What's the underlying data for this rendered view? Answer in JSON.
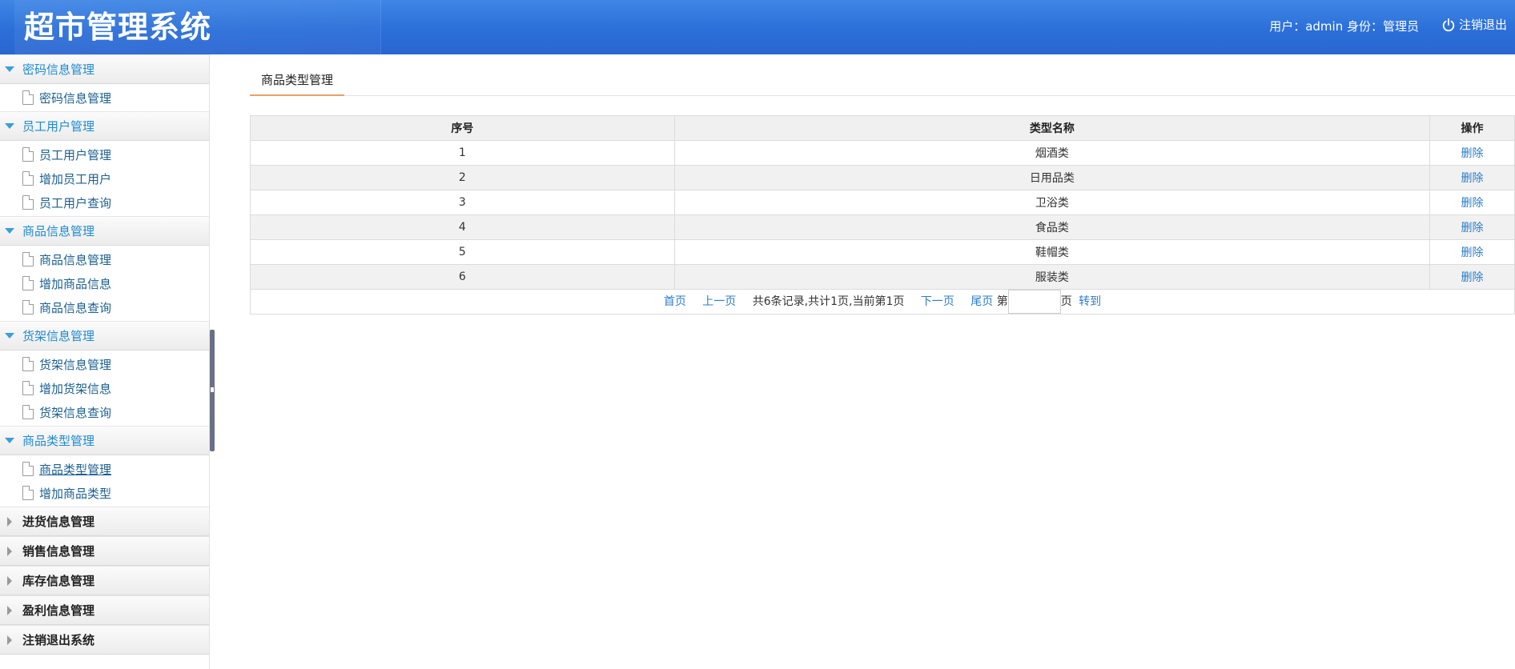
{
  "header": {
    "title": "超市管理系统",
    "user_info": "用户：admin 身份：管理员",
    "logout_label": "注销退出"
  },
  "sidebar": {
    "groups": [
      {
        "label": "密码信息管理",
        "state": "open",
        "items": [
          "密码信息管理"
        ]
      },
      {
        "label": "员工用户管理",
        "state": "open",
        "items": [
          "员工用户管理",
          "增加员工用户",
          "员工用户查询"
        ]
      },
      {
        "label": "商品信息管理",
        "state": "open",
        "items": [
          "商品信息管理",
          "增加商品信息",
          "商品信息查询"
        ]
      },
      {
        "label": "货架信息管理",
        "state": "open",
        "items": [
          "货架信息管理",
          "增加货架信息",
          "货架信息查询"
        ]
      },
      {
        "label": "商品类型管理",
        "state": "open",
        "items": [
          "商品类型管理",
          "增加商品类型"
        ]
      },
      {
        "label": "进货信息管理",
        "state": "closed",
        "items": []
      },
      {
        "label": "销售信息管理",
        "state": "closed",
        "items": []
      },
      {
        "label": "库存信息管理",
        "state": "closed",
        "items": []
      },
      {
        "label": "盈利信息管理",
        "state": "closed",
        "items": []
      },
      {
        "label": "注销退出系统",
        "state": "closed",
        "items": []
      }
    ]
  },
  "main": {
    "tab_label": "商品类型管理",
    "table": {
      "columns": [
        "序号",
        "类型名称",
        "操作"
      ],
      "rows": [
        {
          "index": "1",
          "name": "烟酒类",
          "action": "删除"
        },
        {
          "index": "2",
          "name": "日用品类",
          "action": "删除"
        },
        {
          "index": "3",
          "name": "卫浴类",
          "action": "删除"
        },
        {
          "index": "4",
          "name": "食品类",
          "action": "删除"
        },
        {
          "index": "5",
          "name": "鞋帽类",
          "action": "删除"
        },
        {
          "index": "6",
          "name": "服装类",
          "action": "删除"
        }
      ]
    },
    "pager": {
      "first": "首页",
      "prev": "上一页",
      "info": "共6条记录,共计1页,当前第1页",
      "next": "下一页",
      "last": "尾页",
      "page_prefix": "第",
      "page_input_value": "",
      "page_suffix": "页",
      "go": "转到"
    }
  }
}
